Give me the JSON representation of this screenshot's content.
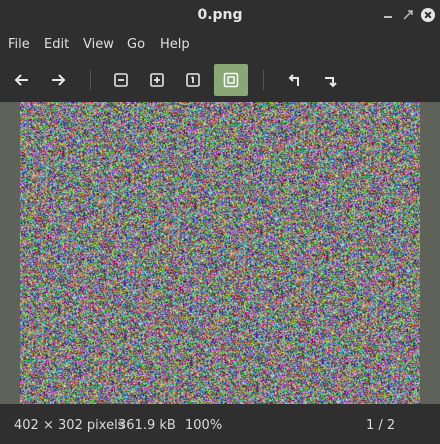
{
  "window": {
    "title": "0.png"
  },
  "menu": {
    "file": "File",
    "edit": "Edit",
    "view": "View",
    "go": "Go",
    "help": "Help"
  },
  "status": {
    "dimensions": "402 × 302 pixels",
    "size": "361.9 kB",
    "zoom": "100%",
    "position": "1 / 2"
  },
  "colors": {
    "accent": "#8aa875",
    "viewer_bg": "#5f6259",
    "chrome_bg": "#2f2f2f"
  }
}
